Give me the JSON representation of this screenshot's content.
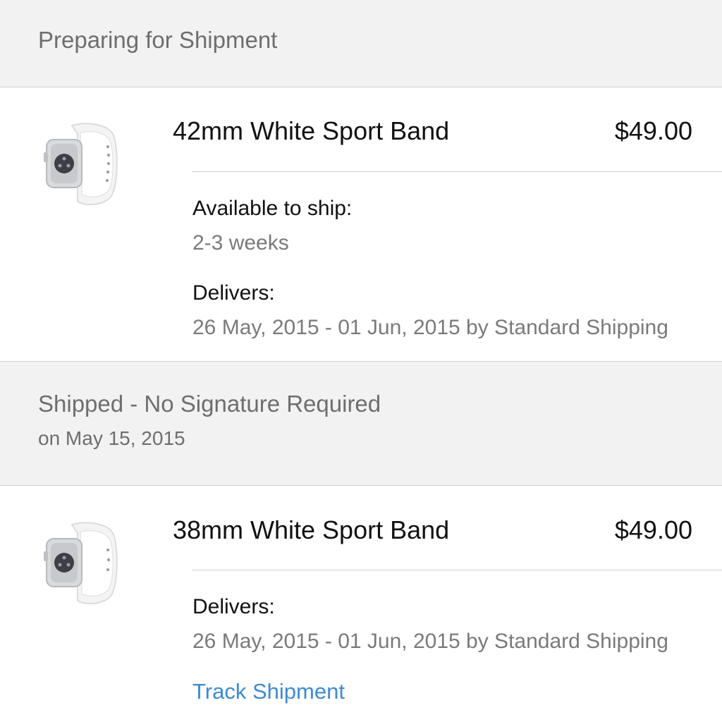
{
  "sections": [
    {
      "header": {
        "title": "Preparing for Shipment"
      },
      "item": {
        "name": "42mm White Sport Band",
        "price": "$49.00",
        "availability_label": "Available to ship:",
        "availability_value": "2-3 weeks",
        "delivers_label": "Delivers:",
        "delivers_value": "26 May, 2015 - 01 Jun, 2015 by Standard Shipping"
      }
    },
    {
      "header": {
        "title": "Shipped - No Signature Required",
        "subtitle": "on May 15, 2015"
      },
      "item": {
        "name": "38mm White Sport Band",
        "price": "$49.00",
        "delivers_label": "Delivers:",
        "delivers_value": "26 May, 2015 - 01 Jun, 2015 by Standard Shipping",
        "track_label": "Track Shipment"
      }
    }
  ],
  "colors": {
    "header_bg": "#f2f2f2",
    "header_text": "#6e6e6e",
    "secondary_text": "#7a7a7a",
    "link": "#3d8bd6",
    "divider": "#cfcfcf"
  },
  "icons": [
    "apple-watch-sport-band-white-image"
  ]
}
